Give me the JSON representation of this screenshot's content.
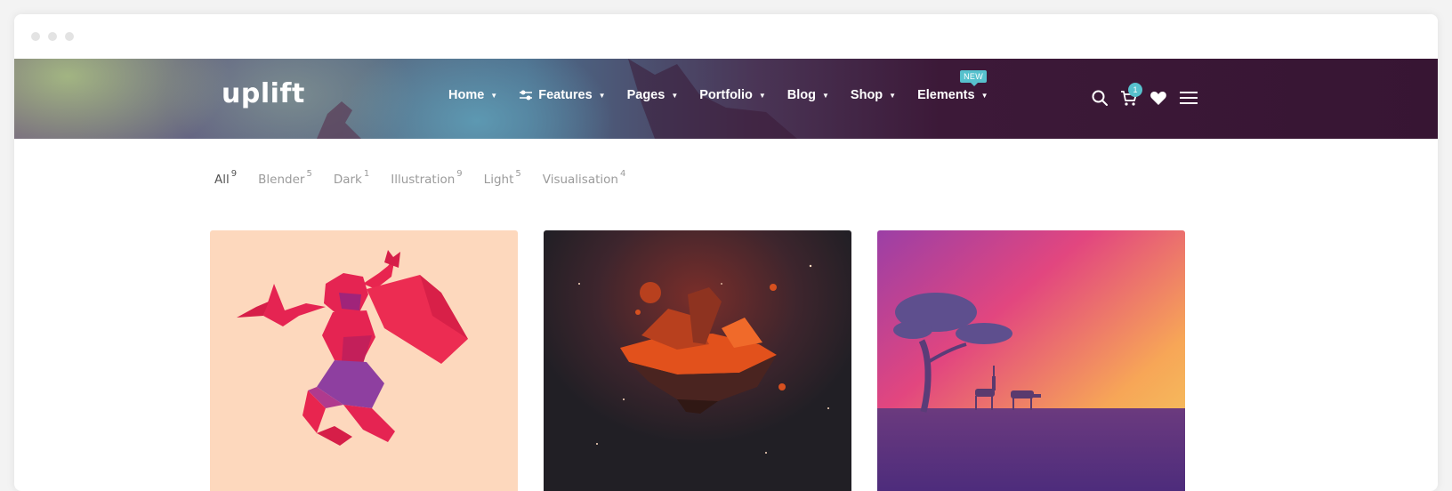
{
  "header": {
    "logo": "uplift",
    "nav": [
      {
        "label": "Home"
      },
      {
        "label": "Features"
      },
      {
        "label": "Pages"
      },
      {
        "label": "Portfolio"
      },
      {
        "label": "Blog"
      },
      {
        "label": "Shop"
      },
      {
        "label": "Elements",
        "badge": "NEW"
      }
    ],
    "cart_count": "1"
  },
  "filters": [
    {
      "label": "All",
      "count": "9"
    },
    {
      "label": "Blender",
      "count": "5"
    },
    {
      "label": "Dark",
      "count": "1"
    },
    {
      "label": "Illustration",
      "count": "9"
    },
    {
      "label": "Light",
      "count": "5"
    },
    {
      "label": "Visualisation",
      "count": "4"
    }
  ],
  "colors": {
    "accent": "#57c1cd",
    "header_dark": "#371533",
    "card1_bg": "#fdd8bd",
    "card2_bg": "#26222a"
  }
}
